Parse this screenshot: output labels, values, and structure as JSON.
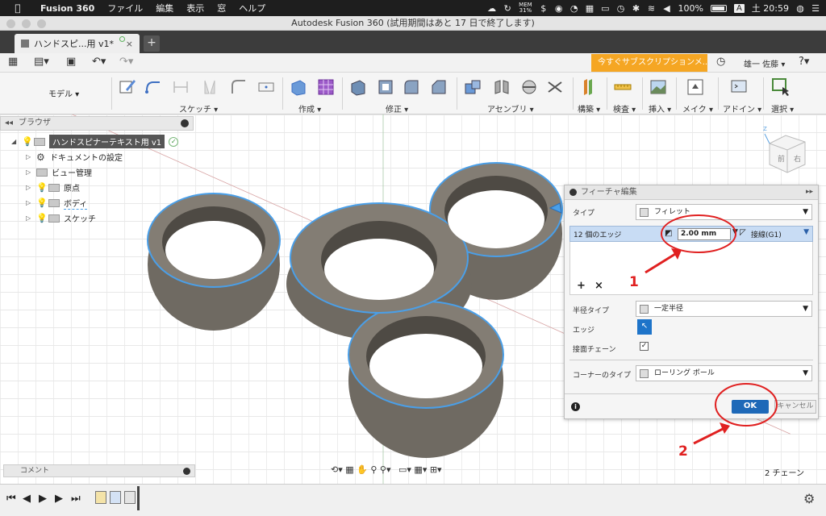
{
  "menubar": {
    "app_name": "Fusion 360",
    "items": [
      "ファイル",
      "編集",
      "表示",
      "窓",
      "ヘルプ"
    ],
    "status": {
      "mem_label": "MEM",
      "mem_value": "31%",
      "battery": "100%",
      "input_source": "A",
      "clock": "土 20:59"
    }
  },
  "window": {
    "title": "Autodesk Fusion 360 (試用期間はあと 17 日で終了します)"
  },
  "doc_tab": {
    "label": "ハンドスピ...用 v1*",
    "close": "×",
    "new_tab": "+"
  },
  "quickbar": {
    "subscribe_label": "今すぐサブスクリプションメ...",
    "user_label": "雄一 佐藤 ▾",
    "help_label": "?"
  },
  "ribbon": {
    "workspace": "モデル ▾",
    "groups": {
      "sketch": "スケッチ ▾",
      "create": "作成 ▾",
      "modify": "修正 ▾",
      "assemble": "アセンブリ ▾",
      "construct": "構築 ▾",
      "inspect": "検査 ▾",
      "insert": "挿入 ▾",
      "make": "メイク ▾",
      "addins": "アドイン ▾",
      "select": "選択 ▾"
    }
  },
  "browser": {
    "title": "ブラウザ",
    "root": "ハンドスピナーテキスト用 v1",
    "items": [
      "ドキュメントの設定",
      "ビュー管理",
      "原点",
      "ボディ",
      "スケッチ"
    ]
  },
  "feature_panel": {
    "title": "フィーチャ編集",
    "type_label": "タイプ",
    "type_value": "フィレット",
    "edges_label": "12 個のエッジ",
    "radius_value": "2.00 mm",
    "continuity_value": "接線(G1)",
    "add_label": "+",
    "remove_label": "×",
    "radius_type_label": "半径タイプ",
    "radius_type_value": "一定半径",
    "edge_label": "エッジ",
    "tangent_chain_label": "接面チェーン",
    "corner_type_label": "コーナーのタイプ",
    "corner_type_value": "ローリング ボール",
    "info": "i",
    "ok": "OK",
    "cancel": "キャンセル"
  },
  "comment_bar": {
    "label": "コメント"
  },
  "status": {
    "chains": "2 チェーン"
  },
  "viewcube": {
    "front": "前",
    "right": "右"
  },
  "annotations": {
    "one": "1",
    "two": "2"
  },
  "colors": {
    "accent_orange": "#f5a623",
    "ok_blue": "#1e69b8",
    "selection_blue": "#4a9fe8",
    "annotation_red": "#e02020"
  }
}
